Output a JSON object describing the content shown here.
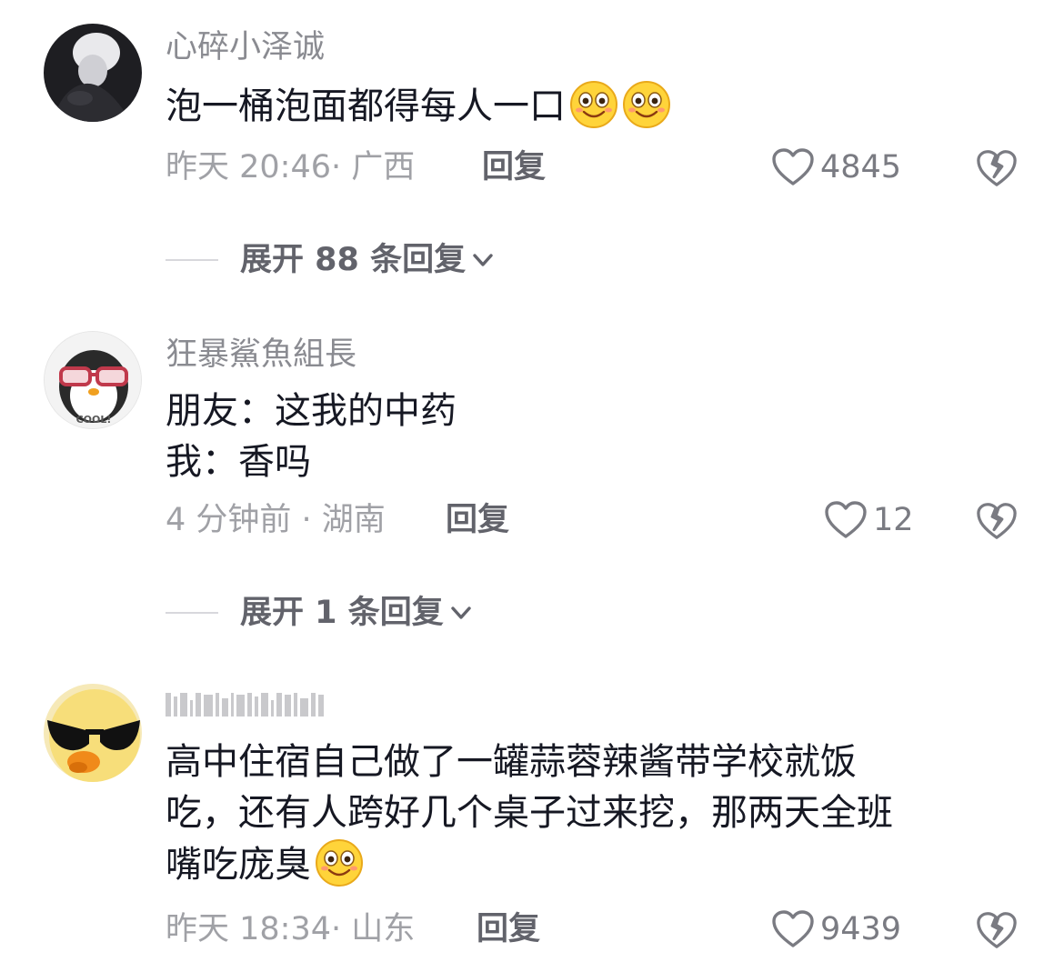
{
  "comments": [
    {
      "username": "心碎小泽诚",
      "avatar_icon": "dark-person-avatar",
      "lines": [
        "泡一桶泡面都得每人一口"
      ],
      "trailing_emoji": [
        "smile-emoji",
        "smile-emoji"
      ],
      "meta": "昨天 20:46· 广西",
      "reply_label": "回复",
      "likes": "4845",
      "expand_label": "展开 88 条回复"
    },
    {
      "username": "狂暴鯊魚組長",
      "avatar_icon": "penguin-cool-avatar",
      "avatar_text": "COOL!",
      "lines": [
        "朋友：这我的中药",
        "我：香吗"
      ],
      "meta": "4 分钟前 · 湖南",
      "reply_label": "回复",
      "likes": "12",
      "expand_label": "展开 1 条回复"
    },
    {
      "username_blurred": true,
      "avatar_icon": "duck-sunglasses-avatar",
      "lines": [
        "高中住宿自己做了一罐蒜蓉辣酱带学校就饭",
        "吃，还有人跨好几个桌子过来挖，那两天全班",
        "嘴吃庞臭"
      ],
      "trailing_emoji": [
        "smile-emoji"
      ],
      "meta": "昨天 18:34· 山东",
      "reply_label": "回复",
      "likes": "9439"
    }
  ],
  "colors": {
    "text_primary": "#161823",
    "text_secondary": "#8a8b91",
    "text_meta": "#a0a1a6",
    "reply": "#62636b",
    "emoji_face": "#ffd43a"
  }
}
